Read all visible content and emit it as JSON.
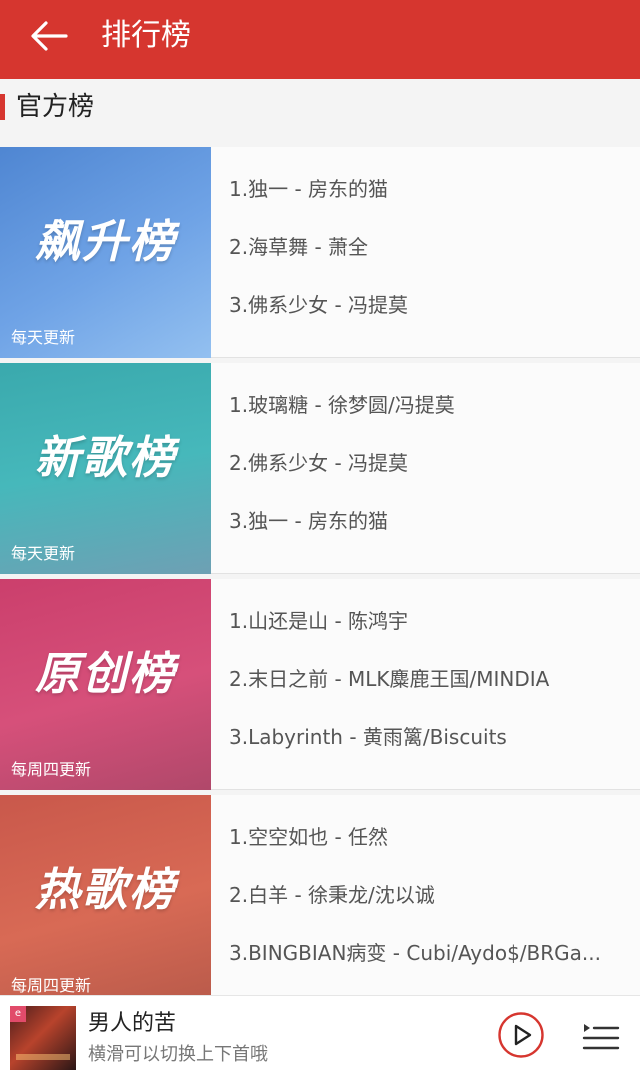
{
  "header": {
    "title": "排行榜",
    "back_icon": "arrow-left-icon"
  },
  "section": {
    "label": "官方榜"
  },
  "charts": [
    {
      "name": "飙升榜",
      "frequency": "每天更新",
      "songs": [
        "1.独一 - 房东的猫",
        "2.海草舞 - 萧全",
        "3.佛系少女 - 冯提莫"
      ]
    },
    {
      "name": "新歌榜",
      "frequency": "每天更新",
      "songs": [
        "1.玻璃糖 - 徐梦圆/冯提莫",
        "2.佛系少女 - 冯提莫",
        "3.独一 - 房东的猫"
      ]
    },
    {
      "name": "原创榜",
      "frequency": "每周四更新",
      "songs": [
        "1.山还是山 - 陈鸿宇",
        "2.末日之前 - MLK麋鹿王国/MINDIA",
        "3.Labyrinth - 黄雨篱/Biscuits"
      ]
    },
    {
      "name": "热歌榜",
      "frequency": "每周四更新",
      "songs": [
        "1.空空如也  - 任然",
        "2.白羊 - 徐秉龙/沈以诚",
        "3.BINGBIAN病变 - Cubi/Aydo$/BRGa..."
      ]
    }
  ],
  "player": {
    "song_title": "男人的苦",
    "hint": "横滑可以切换上下首哦",
    "play_icon": "play-circle-icon",
    "playlist_icon": "playlist-icon"
  },
  "colors": {
    "accent": "#d6362f",
    "cover_1": "#5c93d8",
    "cover_2": "#3fb2b5",
    "cover_3": "#cf4574",
    "cover_4": "#cc5f4f"
  }
}
